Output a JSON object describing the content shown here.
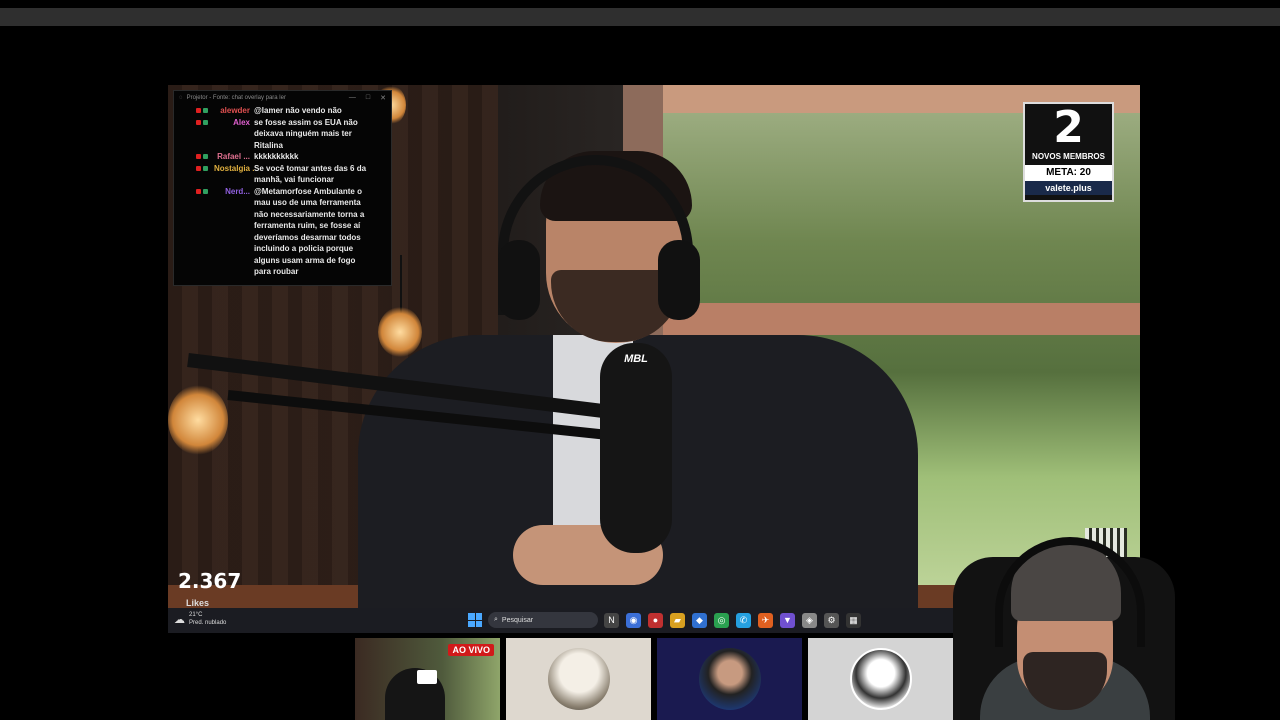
{
  "chat_window": {
    "title": "Projetor - Fonte: chat overlay para ler",
    "controls": [
      "—",
      "□",
      "✕"
    ],
    "messages": [
      {
        "nick": "alewder",
        "text": "@lamer não vendo não",
        "nick_color": "#e05050"
      },
      {
        "nick": "Alex",
        "text": "se fosse assim os EUA não deixava ninguém mais ter Ritalina",
        "nick_color": "#e060d0"
      },
      {
        "nick": "Rafael ...",
        "text": "kkkkkkkkkk",
        "nick_color": "#e07090"
      },
      {
        "nick": "Nostalgia ...",
        "text": "Se você tomar antes das 6 da manhã, vai funcionar",
        "nick_color": "#e0b040"
      },
      {
        "nick": "Nerd...",
        "text": "@Metamorfose Ambulante o mau uso de uma ferramenta não necessariamente torna a ferramenta ruim, se fosse aí deveríamos desarmar todos incluindo a policia porque alguns usam arma de fogo para roubar",
        "nick_color": "#9060e0"
      }
    ]
  },
  "members_badge": {
    "count": "2",
    "label": "NOVOS MEMBROS",
    "goal": "META: 20",
    "site": "valete.plus"
  },
  "stream": {
    "viewer_count": "2.367",
    "likes_label": "Likes",
    "mic_brand": "MBL"
  },
  "taskbar": {
    "temperature": "21°C",
    "weather": "Pred. nublado",
    "search_placeholder": "Pesquisar",
    "apps": [
      "N",
      "◉",
      "●",
      "▰",
      "◆",
      "◎",
      "✆",
      "✈",
      "▼",
      "◈",
      "⚙",
      "▦"
    ]
  },
  "thumbnails": {
    "live_label": "AO VIVO"
  },
  "colors": {
    "windows_accent": "#4aa8ff",
    "live_red": "#d11a1a"
  }
}
